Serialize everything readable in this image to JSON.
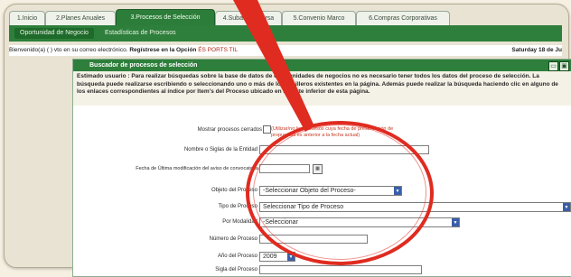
{
  "tabs": [
    {
      "label": "1.Inicio"
    },
    {
      "label": "2.Planes Anuales"
    },
    {
      "label": "3.Procesos de Selección"
    },
    {
      "label": "4.Subasta Inversa"
    },
    {
      "label": "5.Convenio Marco"
    },
    {
      "label": "6.Compras Corporativas"
    }
  ],
  "subtabs": [
    {
      "label": "Oportunidad de Negocio"
    },
    {
      "label": "Estadísticas de Procesos"
    }
  ],
  "welcome": {
    "text": "Bienvenido(a) ( ) vto en su correo electrónico.",
    "register": "Regístrese en la Opción",
    "register_link": "ÉS PORTS TIL",
    "date": "Saturday 18 de Ju"
  },
  "panel": {
    "title": "Buscador de procesos de selección",
    "intro": "Estimado usuario : Para realizar búsquedas sobre la base de datos de oportunidades de negocios no es necesario tener todos los datos del proceso de selección. La búsqueda puede realizarse escribiendo o seleccionando uno o más de los casilleros existentes en la página. Además puede realizar la búsqueda haciendo clic en alguno de los enlaces correspondientes al índice por Item's del Proceso ubicado en la parte inferior de esta página."
  },
  "form": {
    "mostrar_label": "Mostrar procesos cerrados",
    "mostrar_note": "(Utilizar/no los procesos cuya fecha de presentación de propuestas es anterior a la fecha actual)",
    "nombre_label": "Nombre o Siglas de la Entidad",
    "fecha_label": "Fecha de Última modificación del aviso de convocatoria",
    "objeto_label": "Objeto del Proceso",
    "objeto_value": "-Seleccionar Objeto del Proceso-",
    "tipo_label": "Tipo de Proceso",
    "tipo_value": "Seleccionar Tipo de Proceso",
    "modalidad_label": "Por Modalidad",
    "modalidad_value": "-Seleccionar",
    "numero_label": "Número de Proceso",
    "anio_label": "Año del Proceso",
    "anio_value": "2009",
    "sigla_label": "Sigla del Proceso"
  },
  "colors": {
    "accent": "#2e7f3b",
    "highlight": "#e02b20"
  }
}
